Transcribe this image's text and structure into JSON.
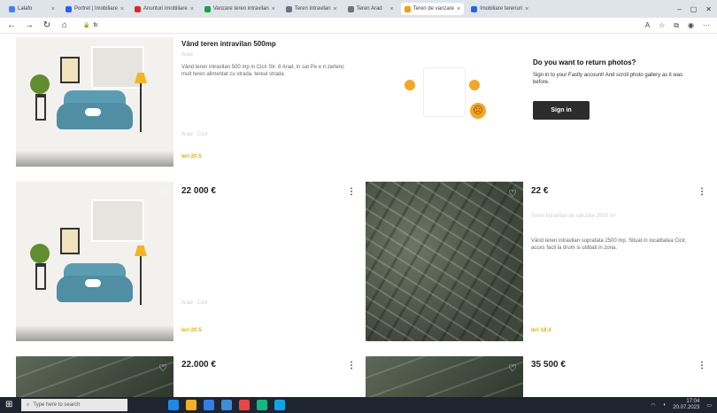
{
  "browser": {
    "tabs": [
      {
        "label": "Lalafo",
        "color": "#3b82f6",
        "active": false
      },
      {
        "label": "Portret | Imobiliare",
        "color": "#2563eb",
        "active": false
      },
      {
        "label": "Anunturi imobiliare",
        "color": "#dc2626",
        "active": false
      },
      {
        "label": "Vanzare teren intravilan",
        "color": "#16a34a",
        "active": false
      },
      {
        "label": "Teren intravilan",
        "color": "#6b7280",
        "active": false
      },
      {
        "label": "Teren Arad",
        "color": "#6b7280",
        "active": false
      },
      {
        "label": "Teren de vanzare",
        "color": "#f59e0b",
        "active": true
      },
      {
        "label": "Imobiliare terenuri",
        "color": "#2563eb",
        "active": false
      }
    ],
    "url_host": "fb"
  },
  "listings": [
    {
      "title": "Vând teren intravilan 500mp",
      "subtitle": "Arad",
      "description": "Vând teren intravilan 500 mp in Cicir Str. 8 Arad, in sat Pe e n zerlenc mult teren alimentat cu strada, tereul strada",
      "location": "Arad · Cicir",
      "badge": "Ieri 20:5"
    },
    {
      "price": "22 000 €",
      "location": "Arad · Cicir",
      "badge": "Ieri 20:5"
    },
    {
      "price": "22 €",
      "subtitle": "Teren intravilan de vânzare 2500 m²",
      "description": "Vând teren intravilan suprafata 2500 mp. Situat in localitatea Cicir, acces facil la drum si utilitati in zona.",
      "badge": "Ieri 18:4"
    },
    {
      "price": "22.000 €"
    },
    {
      "price": "35 500 €"
    }
  ],
  "promo": {
    "title": "Do you want to return photos?",
    "text": "Sign in to your Fastly account! And scroll photo gallery as it was before.",
    "signin_label": "Sign in"
  },
  "taskbar": {
    "search_placeholder": "Type here to search",
    "time": "17:04",
    "date": "20.07.2023",
    "apps": [
      "#1e88e5",
      "#f2b01e",
      "#2f80ed",
      "#3d8bd9",
      "#ef4444",
      "#10b981",
      "#0ea5e9"
    ]
  }
}
